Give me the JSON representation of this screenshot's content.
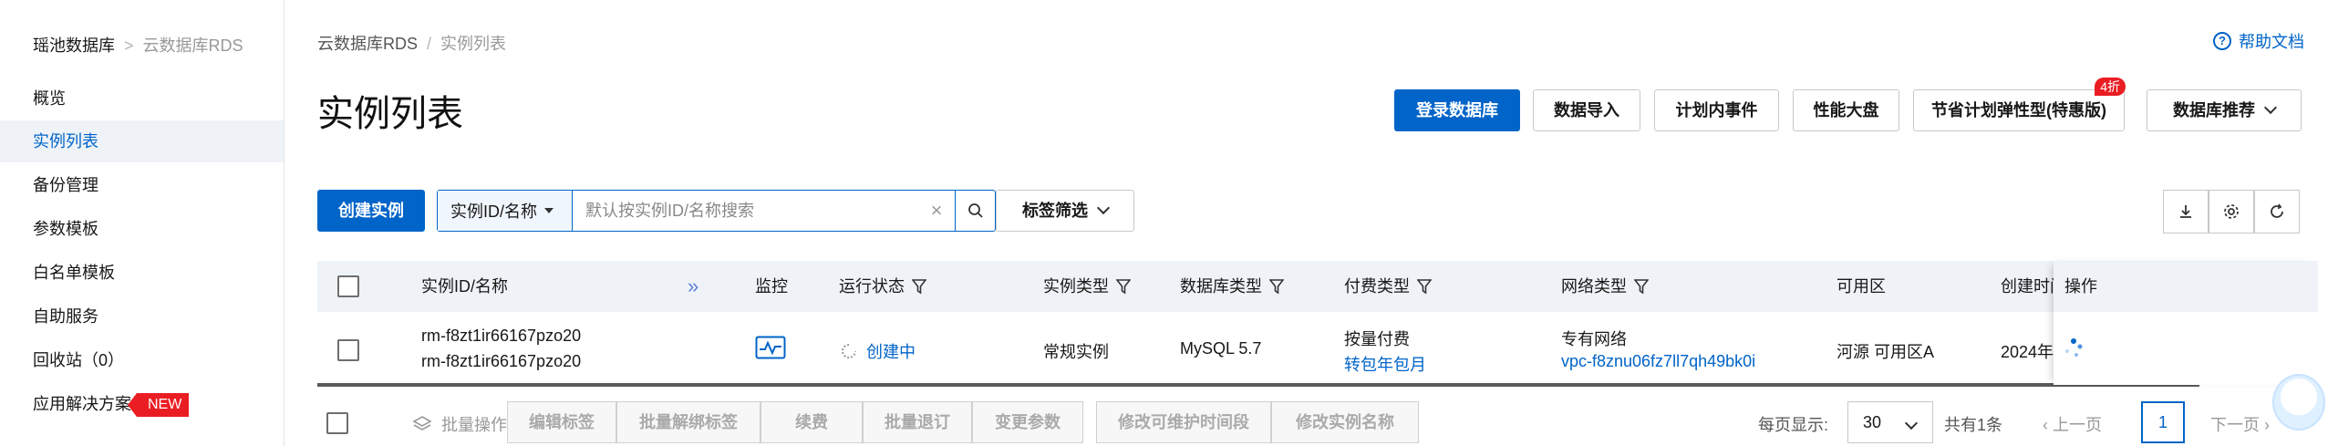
{
  "sidebar": {
    "breadcrumb_root": "瑶池数据库",
    "breadcrumb_separator": ">",
    "breadcrumb_current": "云数据库RDS",
    "items": [
      {
        "label": "概览"
      },
      {
        "label": "实例列表"
      },
      {
        "label": "备份管理"
      },
      {
        "label": "参数模板"
      },
      {
        "label": "白名单模板"
      },
      {
        "label": "自助服务"
      },
      {
        "label": "回收站（0）"
      },
      {
        "label": "应用解决方案"
      }
    ],
    "new_badge": "NEW"
  },
  "header": {
    "breadcrumb_root": "云数据库RDS",
    "breadcrumb_separator": "/",
    "breadcrumb_current": "实例列表",
    "help_label": "帮助文档",
    "page_title": "实例列表"
  },
  "actions": {
    "login_db": "登录数据库",
    "data_import": "数据导入",
    "planned_events": "计划内事件",
    "perf_dashboard": "性能大盘",
    "savings_plan": "节省计划弹性型(特惠版)",
    "savings_badge": "4折",
    "db_recommend": "数据库推荐"
  },
  "toolbar": {
    "create_instance": "创建实例",
    "search_field_selected": "实例ID/名称",
    "search_placeholder": "默认按实例ID/名称搜索",
    "tag_filter": "标签筛选"
  },
  "table": {
    "columns": {
      "instance": "实例ID/名称",
      "monitor": "监控",
      "status": "运行状态",
      "instance_type": "实例类型",
      "db_type": "数据库类型",
      "pay_type": "付费类型",
      "network_type": "网络类型",
      "zone": "可用区",
      "created": "创建时间",
      "ops": "操作"
    },
    "rows": [
      {
        "instance_id": "rm-f8zt1ir66167pzo20",
        "instance_name": "rm-f8zt1ir66167pzo20",
        "status": "创建中",
        "instance_type": "常规实例",
        "db_type": "MySQL 5.7",
        "pay_type": "按量付费",
        "pay_action": "转包年包月",
        "network_type": "专有网络",
        "vpc": "vpc-f8znu06fz7ll7qh49bk0i",
        "zone": "河源 可用区A",
        "created": "2024年"
      }
    ]
  },
  "footer": {
    "batch_label": "批量操作:",
    "batch_buttons": {
      "edit_tags": "编辑标签",
      "unbind_tags": "批量解绑标签",
      "renew": "续费",
      "batch_refund": "批量退订",
      "change_params": "变更参数",
      "maint_window": "修改可维护时间段",
      "rename": "修改实例名称"
    },
    "per_page_label": "每页显示:",
    "page_size": "30",
    "total": "共有1条",
    "prev": "上一页",
    "current_page": "1",
    "next": "下一页"
  },
  "colors": {
    "primary": "#0064c8",
    "danger": "#ea1d23",
    "header_bg": "#eff3f8"
  }
}
